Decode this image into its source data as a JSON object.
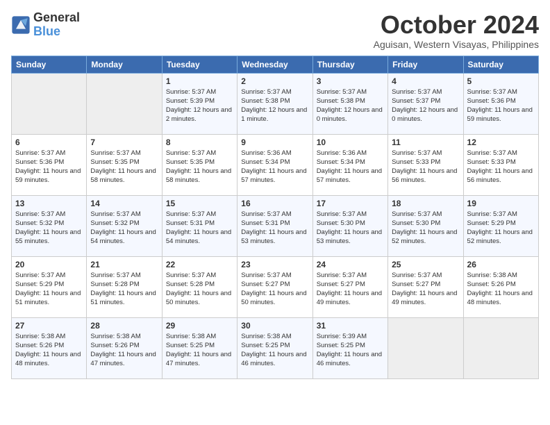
{
  "logo": {
    "line1": "General",
    "line2": "Blue"
  },
  "title": "October 2024",
  "location": "Aguisan, Western Visayas, Philippines",
  "days_header": [
    "Sunday",
    "Monday",
    "Tuesday",
    "Wednesday",
    "Thursday",
    "Friday",
    "Saturday"
  ],
  "weeks": [
    [
      {
        "day": "",
        "empty": true
      },
      {
        "day": "",
        "empty": true
      },
      {
        "day": "1",
        "sunrise": "Sunrise: 5:37 AM",
        "sunset": "Sunset: 5:39 PM",
        "daylight": "Daylight: 12 hours and 2 minutes."
      },
      {
        "day": "2",
        "sunrise": "Sunrise: 5:37 AM",
        "sunset": "Sunset: 5:38 PM",
        "daylight": "Daylight: 12 hours and 1 minute."
      },
      {
        "day": "3",
        "sunrise": "Sunrise: 5:37 AM",
        "sunset": "Sunset: 5:38 PM",
        "daylight": "Daylight: 12 hours and 0 minutes."
      },
      {
        "day": "4",
        "sunrise": "Sunrise: 5:37 AM",
        "sunset": "Sunset: 5:37 PM",
        "daylight": "Daylight: 12 hours and 0 minutes."
      },
      {
        "day": "5",
        "sunrise": "Sunrise: 5:37 AM",
        "sunset": "Sunset: 5:36 PM",
        "daylight": "Daylight: 11 hours and 59 minutes."
      }
    ],
    [
      {
        "day": "6",
        "sunrise": "Sunrise: 5:37 AM",
        "sunset": "Sunset: 5:36 PM",
        "daylight": "Daylight: 11 hours and 59 minutes."
      },
      {
        "day": "7",
        "sunrise": "Sunrise: 5:37 AM",
        "sunset": "Sunset: 5:35 PM",
        "daylight": "Daylight: 11 hours and 58 minutes."
      },
      {
        "day": "8",
        "sunrise": "Sunrise: 5:37 AM",
        "sunset": "Sunset: 5:35 PM",
        "daylight": "Daylight: 11 hours and 58 minutes."
      },
      {
        "day": "9",
        "sunrise": "Sunrise: 5:36 AM",
        "sunset": "Sunset: 5:34 PM",
        "daylight": "Daylight: 11 hours and 57 minutes."
      },
      {
        "day": "10",
        "sunrise": "Sunrise: 5:36 AM",
        "sunset": "Sunset: 5:34 PM",
        "daylight": "Daylight: 11 hours and 57 minutes."
      },
      {
        "day": "11",
        "sunrise": "Sunrise: 5:37 AM",
        "sunset": "Sunset: 5:33 PM",
        "daylight": "Daylight: 11 hours and 56 minutes."
      },
      {
        "day": "12",
        "sunrise": "Sunrise: 5:37 AM",
        "sunset": "Sunset: 5:33 PM",
        "daylight": "Daylight: 11 hours and 56 minutes."
      }
    ],
    [
      {
        "day": "13",
        "sunrise": "Sunrise: 5:37 AM",
        "sunset": "Sunset: 5:32 PM",
        "daylight": "Daylight: 11 hours and 55 minutes."
      },
      {
        "day": "14",
        "sunrise": "Sunrise: 5:37 AM",
        "sunset": "Sunset: 5:32 PM",
        "daylight": "Daylight: 11 hours and 54 minutes."
      },
      {
        "day": "15",
        "sunrise": "Sunrise: 5:37 AM",
        "sunset": "Sunset: 5:31 PM",
        "daylight": "Daylight: 11 hours and 54 minutes."
      },
      {
        "day": "16",
        "sunrise": "Sunrise: 5:37 AM",
        "sunset": "Sunset: 5:31 PM",
        "daylight": "Daylight: 11 hours and 53 minutes."
      },
      {
        "day": "17",
        "sunrise": "Sunrise: 5:37 AM",
        "sunset": "Sunset: 5:30 PM",
        "daylight": "Daylight: 11 hours and 53 minutes."
      },
      {
        "day": "18",
        "sunrise": "Sunrise: 5:37 AM",
        "sunset": "Sunset: 5:30 PM",
        "daylight": "Daylight: 11 hours and 52 minutes."
      },
      {
        "day": "19",
        "sunrise": "Sunrise: 5:37 AM",
        "sunset": "Sunset: 5:29 PM",
        "daylight": "Daylight: 11 hours and 52 minutes."
      }
    ],
    [
      {
        "day": "20",
        "sunrise": "Sunrise: 5:37 AM",
        "sunset": "Sunset: 5:29 PM",
        "daylight": "Daylight: 11 hours and 51 minutes."
      },
      {
        "day": "21",
        "sunrise": "Sunrise: 5:37 AM",
        "sunset": "Sunset: 5:28 PM",
        "daylight": "Daylight: 11 hours and 51 minutes."
      },
      {
        "day": "22",
        "sunrise": "Sunrise: 5:37 AM",
        "sunset": "Sunset: 5:28 PM",
        "daylight": "Daylight: 11 hours and 50 minutes."
      },
      {
        "day": "23",
        "sunrise": "Sunrise: 5:37 AM",
        "sunset": "Sunset: 5:27 PM",
        "daylight": "Daylight: 11 hours and 50 minutes."
      },
      {
        "day": "24",
        "sunrise": "Sunrise: 5:37 AM",
        "sunset": "Sunset: 5:27 PM",
        "daylight": "Daylight: 11 hours and 49 minutes."
      },
      {
        "day": "25",
        "sunrise": "Sunrise: 5:37 AM",
        "sunset": "Sunset: 5:27 PM",
        "daylight": "Daylight: 11 hours and 49 minutes."
      },
      {
        "day": "26",
        "sunrise": "Sunrise: 5:38 AM",
        "sunset": "Sunset: 5:26 PM",
        "daylight": "Daylight: 11 hours and 48 minutes."
      }
    ],
    [
      {
        "day": "27",
        "sunrise": "Sunrise: 5:38 AM",
        "sunset": "Sunset: 5:26 PM",
        "daylight": "Daylight: 11 hours and 48 minutes."
      },
      {
        "day": "28",
        "sunrise": "Sunrise: 5:38 AM",
        "sunset": "Sunset: 5:26 PM",
        "daylight": "Daylight: 11 hours and 47 minutes."
      },
      {
        "day": "29",
        "sunrise": "Sunrise: 5:38 AM",
        "sunset": "Sunset: 5:25 PM",
        "daylight": "Daylight: 11 hours and 47 minutes."
      },
      {
        "day": "30",
        "sunrise": "Sunrise: 5:38 AM",
        "sunset": "Sunset: 5:25 PM",
        "daylight": "Daylight: 11 hours and 46 minutes."
      },
      {
        "day": "31",
        "sunrise": "Sunrise: 5:39 AM",
        "sunset": "Sunset: 5:25 PM",
        "daylight": "Daylight: 11 hours and 46 minutes."
      },
      {
        "day": "",
        "empty": true
      },
      {
        "day": "",
        "empty": true
      }
    ]
  ]
}
